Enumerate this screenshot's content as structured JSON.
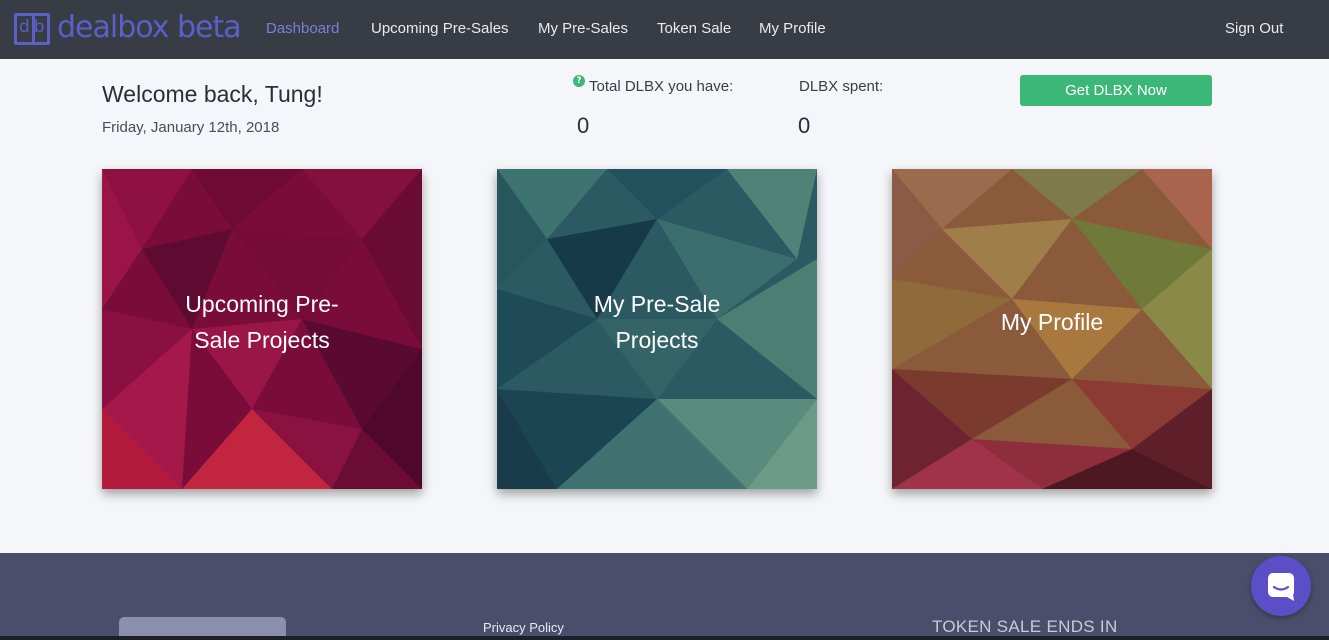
{
  "brand": {
    "name": "dealbox beta",
    "mark": "db",
    "color": "#5b5fc7"
  },
  "nav": {
    "items": [
      {
        "label": "Dashboard",
        "active": true
      },
      {
        "label": "Upcoming Pre-Sales",
        "active": false
      },
      {
        "label": "My Pre-Sales",
        "active": false
      },
      {
        "label": "Token Sale",
        "active": false
      },
      {
        "label": "My Profile",
        "active": false
      }
    ],
    "sign_out": "Sign Out"
  },
  "header": {
    "welcome": "Welcome back, Tung!",
    "date": "Friday, January 12th, 2018"
  },
  "stats": {
    "total": {
      "label": "Total DLBX you have:",
      "value": "0",
      "help_icon": "question-circle-icon"
    },
    "spent": {
      "label": "DLBX spent:",
      "value": "0"
    }
  },
  "cta": {
    "label": "Get DLBX Now",
    "color": "#3bb878"
  },
  "tiles": [
    {
      "label": "Upcoming Pre-Sale Projects",
      "line1": "Upcoming Pre-",
      "line2": "Sale Projects",
      "color": "#8a0f3c"
    },
    {
      "label": "My Pre-Sale Projects",
      "line1": "My Pre-Sale",
      "line2": "Projects",
      "color": "#2e5a63"
    },
    {
      "label": "My Profile",
      "color": "#8a5a3a"
    }
  ],
  "footer": {
    "privacy": "Privacy Policy",
    "countdown_label": "TOKEN SALE ENDS IN",
    "chat_icon": "chat-bubble-icon"
  }
}
